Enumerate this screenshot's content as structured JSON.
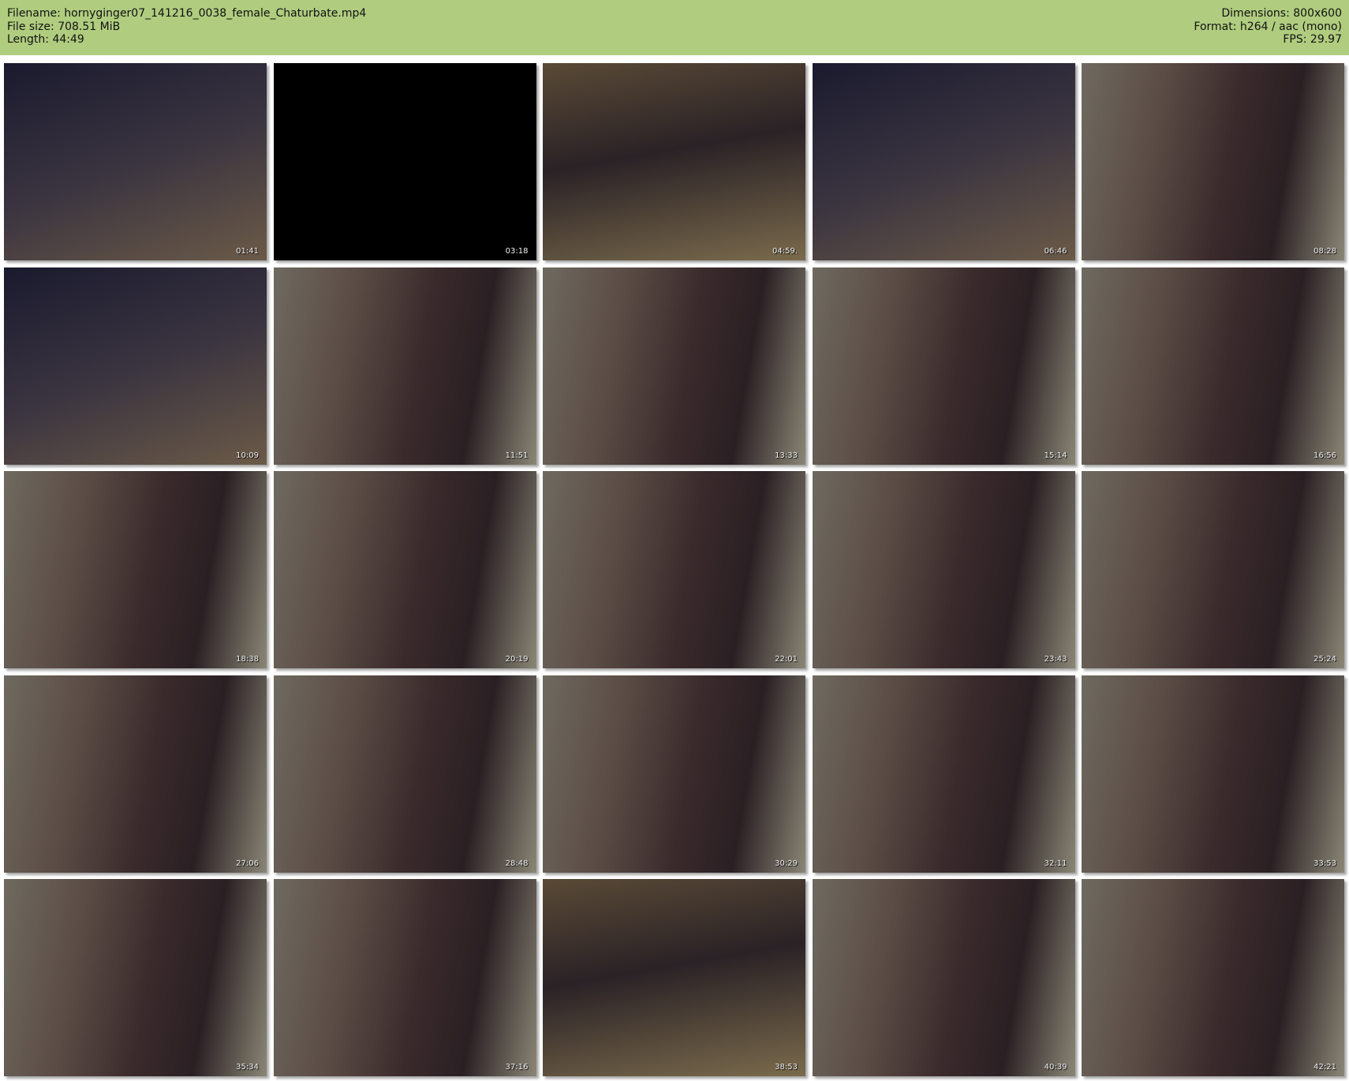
{
  "header": {
    "filename": "Filename: hornyginger07_141216_0038_female_Chaturbate.mp4",
    "file_size": "File size: 708.51 MiB",
    "length": "Length: 44:49",
    "dimensions": "Dimensions: 800x600",
    "format": "Format: h264 / aac (mono)",
    "fps": "FPS: 29.97"
  },
  "colors": {
    "header_bg": "#b0cd7f"
  },
  "thumbnails": [
    {
      "time": "01:41",
      "tone": "dim"
    },
    {
      "time": "03:18",
      "tone": "black"
    },
    {
      "time": "04:59.",
      "tone": "warm"
    },
    {
      "time": "06:46",
      "tone": "dim"
    },
    {
      "time": "08:28",
      "tone": "room"
    },
    {
      "time": "10:09",
      "tone": "dim"
    },
    {
      "time": "11:51",
      "tone": "room"
    },
    {
      "time": "13:33",
      "tone": "room"
    },
    {
      "time": "15:14",
      "tone": "room"
    },
    {
      "time": "16:56",
      "tone": "room"
    },
    {
      "time": "18:38",
      "tone": "room"
    },
    {
      "time": "20:19",
      "tone": "room"
    },
    {
      "time": "22:01",
      "tone": "room"
    },
    {
      "time": "23:43",
      "tone": "room"
    },
    {
      "time": "25:24",
      "tone": "room"
    },
    {
      "time": "27:06",
      "tone": "room"
    },
    {
      "time": "28:48",
      "tone": "room"
    },
    {
      "time": "30:29",
      "tone": "room"
    },
    {
      "time": "32:11",
      "tone": "room"
    },
    {
      "time": "33:53",
      "tone": "room"
    },
    {
      "time": "35:34",
      "tone": "room"
    },
    {
      "time": "37:16",
      "tone": "room"
    },
    {
      "time": "38:53",
      "tone": "warm"
    },
    {
      "time": "40:39",
      "tone": "room"
    },
    {
      "time": "42:21",
      "tone": "room"
    }
  ]
}
